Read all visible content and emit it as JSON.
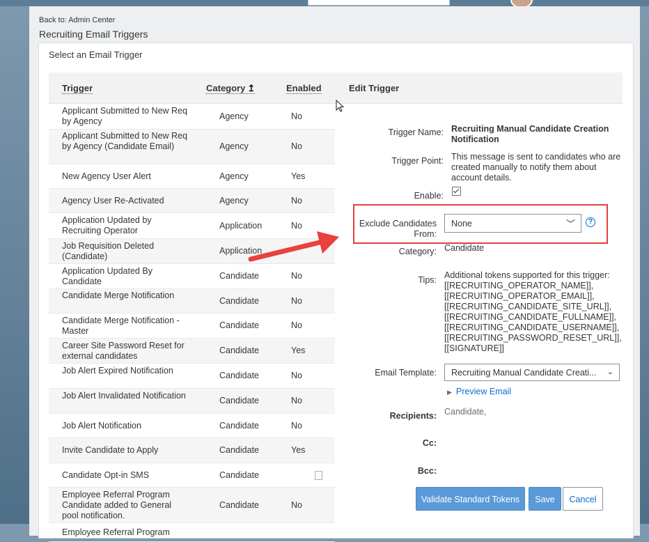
{
  "breadcrumb": {
    "back_label": "Back to: Admin Center"
  },
  "page": {
    "title": "Recruiting Email Triggers",
    "section_title": "Select an Email Trigger"
  },
  "table": {
    "headers": {
      "trigger": "Trigger",
      "category": "Category",
      "enabled": "Enabled"
    },
    "rows": [
      {
        "name": "Applicant Submitted to New Req by Agency",
        "category": "Agency",
        "enabled": "No"
      },
      {
        "name": "Applicant Submitted to New Req by Agency (Candidate Email)",
        "category": "Agency",
        "enabled": "No"
      },
      {
        "name": "New Agency User Alert",
        "category": "Agency",
        "enabled": "Yes"
      },
      {
        "name": "Agency User Re-Activated",
        "category": "Agency",
        "enabled": "No"
      },
      {
        "name": "Application Updated by Recruiting Operator",
        "category": "Application",
        "enabled": "No"
      },
      {
        "name": "Job Requisition Deleted (Candidate)",
        "category": "Application",
        "enabled": ""
      },
      {
        "name": "Application Updated By Candidate",
        "category": "Candidate",
        "enabled": "No"
      },
      {
        "name": "Candidate Merge Notification",
        "category": "Candidate",
        "enabled": "No"
      },
      {
        "name": "Candidate Merge Notification - Master",
        "category": "Candidate",
        "enabled": "No"
      },
      {
        "name": "Career Site Password Reset for external candidates",
        "category": "Candidate",
        "enabled": "Yes"
      },
      {
        "name": "Job Alert Expired Notification",
        "category": "Candidate",
        "enabled": "No"
      },
      {
        "name": "Job Alert Invalidated Notification",
        "category": "Candidate",
        "enabled": "No"
      },
      {
        "name": "Job Alert Notification",
        "category": "Candidate",
        "enabled": "No"
      },
      {
        "name": "Invite Candidate to Apply",
        "category": "Candidate",
        "enabled": "Yes"
      },
      {
        "name": "Candidate Opt-in SMS",
        "category": "Candidate",
        "enabled": ""
      },
      {
        "name": "Employee Referral Program Candidate added to General pool notification.",
        "category": "Candidate",
        "enabled": "No"
      },
      {
        "name": "Employee Referral Program",
        "category": "",
        "enabled": ""
      }
    ]
  },
  "edit": {
    "heading": "Edit Trigger",
    "trigger_name_label": "Trigger Name:",
    "trigger_name": "Recruiting Manual Candidate Creation Notification",
    "trigger_point_label": "Trigger Point:",
    "trigger_point": "This message is sent to candidates who are created manually to notify them about account details.",
    "enable_label": "Enable:",
    "exclude_label": "Exclude Candidates From:",
    "exclude_value": "None",
    "category_label": "Category:",
    "category_value": "Candidate",
    "tips_label": "Tips:",
    "tips_lines": [
      "Additional tokens supported for this trigger:",
      "[[RECRUITING_OPERATOR_NAME]],",
      "[[RECRUITING_OPERATOR_EMAIL]],",
      "[[RECRUITING_CANDIDATE_SITE_URL]],",
      "[[RECRUITING_CANDIDATE_FULLNAME]],",
      "[[RECRUITING_CANDIDATE_USERNAME]],",
      "[[RECRUITING_PASSWORD_RESET_URL]],",
      "[[SIGNATURE]]"
    ],
    "email_template_label": "Email Template:",
    "email_template_value": "Recruiting Manual Candidate Creati...",
    "preview_label": "Preview Email",
    "recipients_label": "Recipients:",
    "recipients_value": "Candidate,",
    "cc_label": "Cc:",
    "bcc_label": "Bcc:",
    "validate_label": "Validate Standard Tokens",
    "save_label": "Save",
    "cancel_label": "Cancel"
  },
  "colors": {
    "accent": "#0a6ed1",
    "primary_button": "#5a9ad8",
    "highlight": "#e04040"
  }
}
